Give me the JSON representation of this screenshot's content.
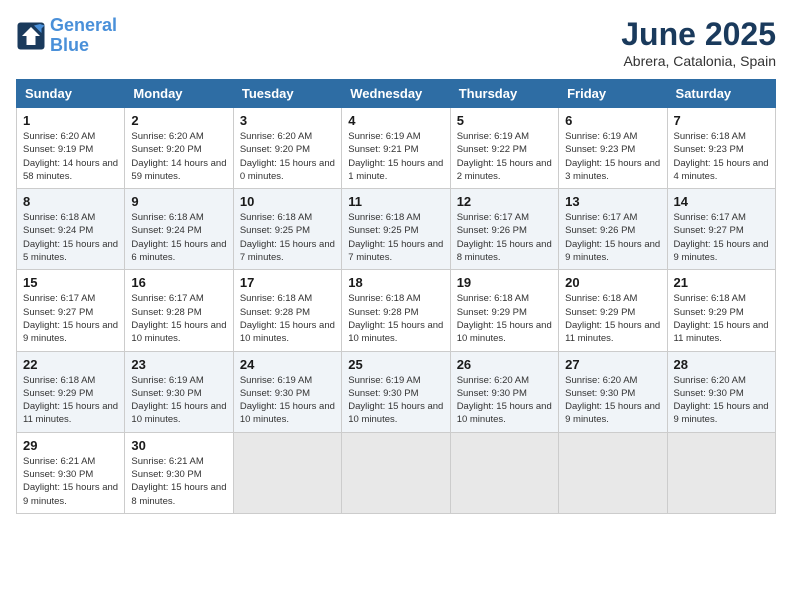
{
  "header": {
    "logo_line1": "General",
    "logo_line2": "Blue",
    "month": "June 2025",
    "location": "Abrera, Catalonia, Spain"
  },
  "days_of_week": [
    "Sunday",
    "Monday",
    "Tuesday",
    "Wednesday",
    "Thursday",
    "Friday",
    "Saturday"
  ],
  "weeks": [
    [
      {
        "day": "1",
        "sunrise": "6:20 AM",
        "sunset": "9:19 PM",
        "daylight": "14 hours and 58 minutes."
      },
      {
        "day": "2",
        "sunrise": "6:20 AM",
        "sunset": "9:20 PM",
        "daylight": "14 hours and 59 minutes."
      },
      {
        "day": "3",
        "sunrise": "6:20 AM",
        "sunset": "9:20 PM",
        "daylight": "15 hours and 0 minutes."
      },
      {
        "day": "4",
        "sunrise": "6:19 AM",
        "sunset": "9:21 PM",
        "daylight": "15 hours and 1 minute."
      },
      {
        "day": "5",
        "sunrise": "6:19 AM",
        "sunset": "9:22 PM",
        "daylight": "15 hours and 2 minutes."
      },
      {
        "day": "6",
        "sunrise": "6:19 AM",
        "sunset": "9:23 PM",
        "daylight": "15 hours and 3 minutes."
      },
      {
        "day": "7",
        "sunrise": "6:18 AM",
        "sunset": "9:23 PM",
        "daylight": "15 hours and 4 minutes."
      }
    ],
    [
      {
        "day": "8",
        "sunrise": "6:18 AM",
        "sunset": "9:24 PM",
        "daylight": "15 hours and 5 minutes."
      },
      {
        "day": "9",
        "sunrise": "6:18 AM",
        "sunset": "9:24 PM",
        "daylight": "15 hours and 6 minutes."
      },
      {
        "day": "10",
        "sunrise": "6:18 AM",
        "sunset": "9:25 PM",
        "daylight": "15 hours and 7 minutes."
      },
      {
        "day": "11",
        "sunrise": "6:18 AM",
        "sunset": "9:25 PM",
        "daylight": "15 hours and 7 minutes."
      },
      {
        "day": "12",
        "sunrise": "6:17 AM",
        "sunset": "9:26 PM",
        "daylight": "15 hours and 8 minutes."
      },
      {
        "day": "13",
        "sunrise": "6:17 AM",
        "sunset": "9:26 PM",
        "daylight": "15 hours and 9 minutes."
      },
      {
        "day": "14",
        "sunrise": "6:17 AM",
        "sunset": "9:27 PM",
        "daylight": "15 hours and 9 minutes."
      }
    ],
    [
      {
        "day": "15",
        "sunrise": "6:17 AM",
        "sunset": "9:27 PM",
        "daylight": "15 hours and 9 minutes."
      },
      {
        "day": "16",
        "sunrise": "6:17 AM",
        "sunset": "9:28 PM",
        "daylight": "15 hours and 10 minutes."
      },
      {
        "day": "17",
        "sunrise": "6:18 AM",
        "sunset": "9:28 PM",
        "daylight": "15 hours and 10 minutes."
      },
      {
        "day": "18",
        "sunrise": "6:18 AM",
        "sunset": "9:28 PM",
        "daylight": "15 hours and 10 minutes."
      },
      {
        "day": "19",
        "sunrise": "6:18 AM",
        "sunset": "9:29 PM",
        "daylight": "15 hours and 10 minutes."
      },
      {
        "day": "20",
        "sunrise": "6:18 AM",
        "sunset": "9:29 PM",
        "daylight": "15 hours and 11 minutes."
      },
      {
        "day": "21",
        "sunrise": "6:18 AM",
        "sunset": "9:29 PM",
        "daylight": "15 hours and 11 minutes."
      }
    ],
    [
      {
        "day": "22",
        "sunrise": "6:18 AM",
        "sunset": "9:29 PM",
        "daylight": "15 hours and 11 minutes."
      },
      {
        "day": "23",
        "sunrise": "6:19 AM",
        "sunset": "9:30 PM",
        "daylight": "15 hours and 10 minutes."
      },
      {
        "day": "24",
        "sunrise": "6:19 AM",
        "sunset": "9:30 PM",
        "daylight": "15 hours and 10 minutes."
      },
      {
        "day": "25",
        "sunrise": "6:19 AM",
        "sunset": "9:30 PM",
        "daylight": "15 hours and 10 minutes."
      },
      {
        "day": "26",
        "sunrise": "6:20 AM",
        "sunset": "9:30 PM",
        "daylight": "15 hours and 10 minutes."
      },
      {
        "day": "27",
        "sunrise": "6:20 AM",
        "sunset": "9:30 PM",
        "daylight": "15 hours and 9 minutes."
      },
      {
        "day": "28",
        "sunrise": "6:20 AM",
        "sunset": "9:30 PM",
        "daylight": "15 hours and 9 minutes."
      }
    ],
    [
      {
        "day": "29",
        "sunrise": "6:21 AM",
        "sunset": "9:30 PM",
        "daylight": "15 hours and 9 minutes."
      },
      {
        "day": "30",
        "sunrise": "6:21 AM",
        "sunset": "9:30 PM",
        "daylight": "15 hours and 8 minutes."
      },
      null,
      null,
      null,
      null,
      null
    ]
  ]
}
